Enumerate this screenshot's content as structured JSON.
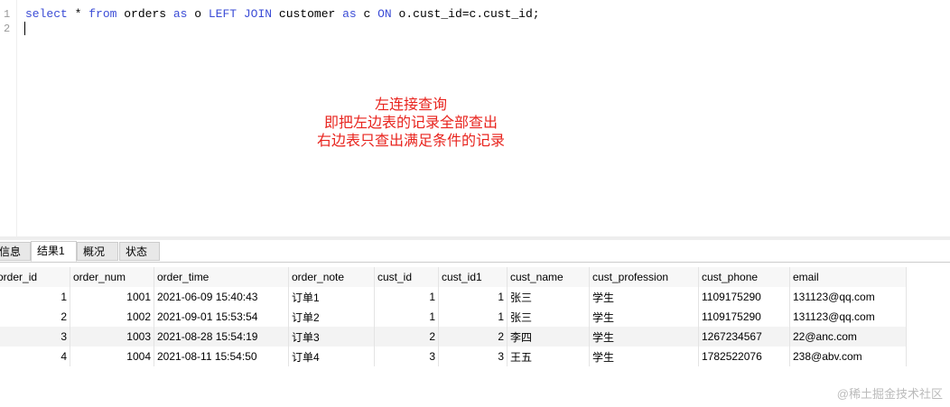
{
  "editor": {
    "line_numbers": [
      "1",
      "2"
    ],
    "tokens": [
      {
        "t": "select",
        "k": true
      },
      {
        "t": " * ",
        "k": false
      },
      {
        "t": "from",
        "k": true
      },
      {
        "t": " orders ",
        "k": false
      },
      {
        "t": "as",
        "k": true
      },
      {
        "t": " o ",
        "k": false
      },
      {
        "t": "LEFT JOIN",
        "k": true
      },
      {
        "t": " customer ",
        "k": false
      },
      {
        "t": "as",
        "k": true
      },
      {
        "t": " c ",
        "k": false
      },
      {
        "t": "ON",
        "k": true
      },
      {
        "t": " o.cust_id=c.cust_id;",
        "k": false
      }
    ]
  },
  "annotation": [
    "左连接查询",
    "即把左边表的记录全部查出",
    "右边表只查出满足条件的记录"
  ],
  "tabs": [
    "信息",
    "结果1",
    "概况",
    "状态"
  ],
  "table": {
    "columns": [
      "order_id",
      "order_num",
      "order_time",
      "order_note",
      "cust_id",
      "cust_id1",
      "cust_name",
      "cust_profession",
      "cust_phone",
      "email"
    ],
    "rows": [
      [
        "1",
        "1001",
        "2021-06-09 15:40:43",
        "订单1",
        "1",
        "1",
        "张三",
        "学生",
        "1109175290",
        "131123@qq.com"
      ],
      [
        "2",
        "1002",
        "2021-09-01 15:53:54",
        "订单2",
        "1",
        "1",
        "张三",
        "学生",
        "1109175290",
        "131123@qq.com"
      ],
      [
        "3",
        "1003",
        "2021-08-28 15:54:19",
        "订单3",
        "2",
        "2",
        "李四",
        "学生",
        "1267234567",
        "22@anc.com"
      ],
      [
        "4",
        "1004",
        "2021-08-11 15:54:50",
        "订单4",
        "3",
        "3",
        "王五",
        "学生",
        "1782522076",
        "238@abv.com"
      ]
    ]
  },
  "watermark": "@稀土掘金技术社区",
  "colors": {
    "keyword": "#3b4cd6",
    "annotation": "#e8231d"
  }
}
